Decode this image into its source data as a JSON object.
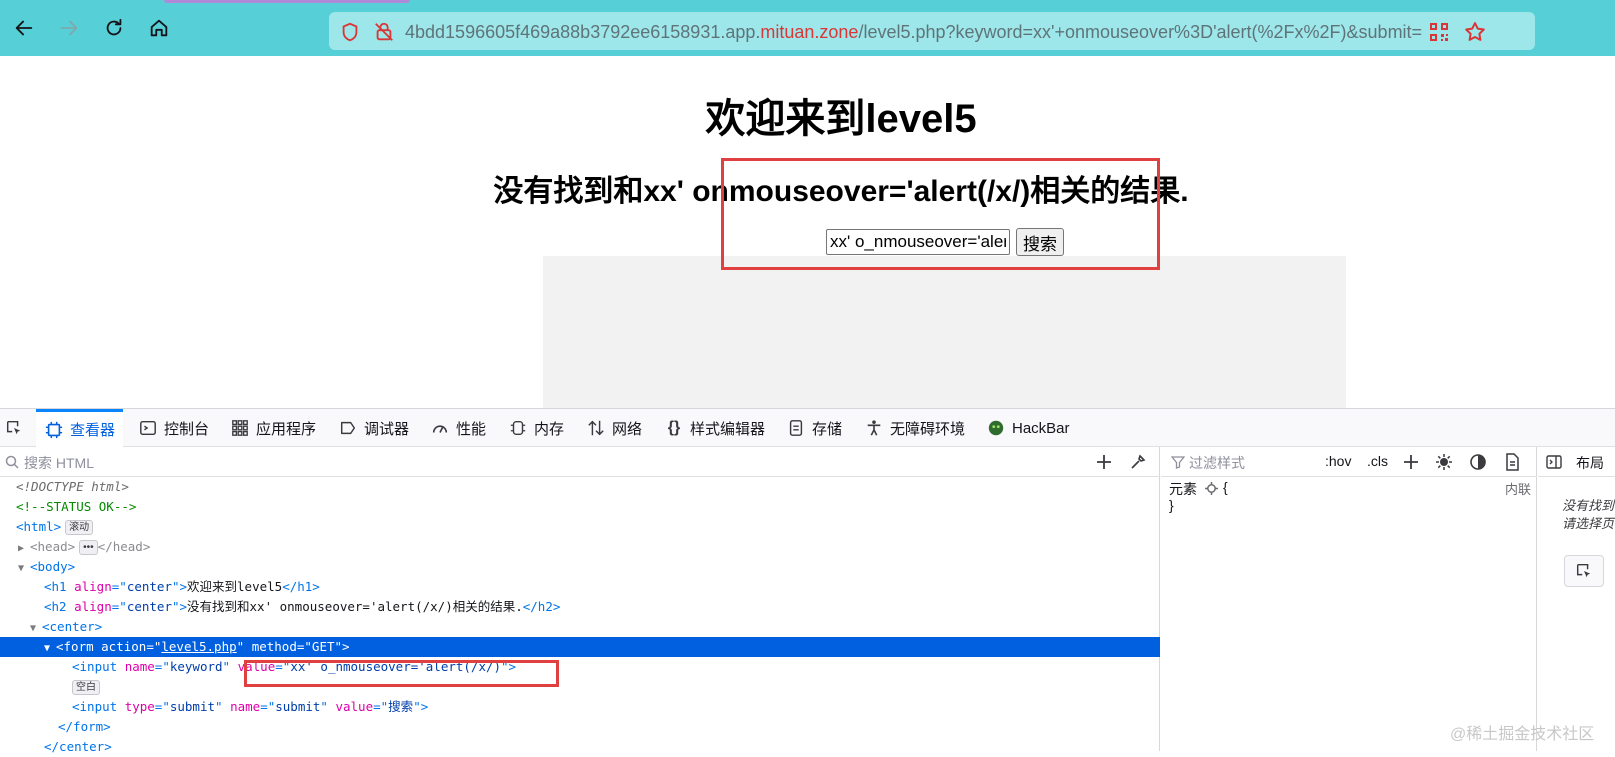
{
  "browser": {
    "url_prefix": "4bdd1596605f469a88b3792ee6158931.app.",
    "url_domain": "mituan.zone",
    "url_suffix": "/level5.php?keyword=xx'+onmouseover%3D'alert(%2Fx%2F)&submit=",
    "accent_color": "#56cfd6"
  },
  "page": {
    "h1": "欢迎来到level5",
    "h2": "没有找到和xx' onmouseover='alert(/x/)相关的结果.",
    "keyword_value": "xx' o_nmouseover='alert(/x/)'",
    "submit_label": "搜索"
  },
  "devtools": {
    "tabs": [
      {
        "label": "查看器",
        "icon": "inspector-icon"
      },
      {
        "label": "控制台",
        "icon": "console-icon"
      },
      {
        "label": "应用程序",
        "icon": "application-icon"
      },
      {
        "label": "调试器",
        "icon": "debugger-icon"
      },
      {
        "label": "性能",
        "icon": "performance-icon"
      },
      {
        "label": "内存",
        "icon": "memory-icon"
      },
      {
        "label": "网络",
        "icon": "network-icon"
      },
      {
        "label": "样式编辑器",
        "icon": "style-editor-icon"
      },
      {
        "label": "存储",
        "icon": "storage-icon"
      },
      {
        "label": "无障碍环境",
        "icon": "accessibility-icon"
      },
      {
        "label": "HackBar",
        "icon": "hackbar-icon"
      }
    ],
    "search_placeholder": "搜索 HTML",
    "markup": {
      "doctype": "<!DOCTYPE html>",
      "comment": "<!--STATUS OK-->",
      "html_badge": "滚动",
      "head_line": "</head>",
      "h1_text": "欢迎来到level5",
      "h2_text": "没有找到和xx' onmouseover='alert(/x/)相关的结果.",
      "form_action": "level5.php",
      "form_method": "GET",
      "input_name": "keyword",
      "input_value": "xx' o_nmouseover='alert(/x/)",
      "empty_badge": "空白",
      "submit_type": "submit",
      "submit_name": "submit",
      "submit_value": "搜索"
    },
    "rules": {
      "filter_placeholder": "过滤样式",
      "hov": ":hov",
      "cls": ".cls",
      "element_label": "元素",
      "inline_label": "内联",
      "open_brace": "{",
      "close_brace": "}"
    },
    "layout": {
      "tab_label": "布局",
      "line1": "没有找到",
      "line2": "请选择页"
    }
  },
  "watermark": "@稀土掘金技术社区"
}
